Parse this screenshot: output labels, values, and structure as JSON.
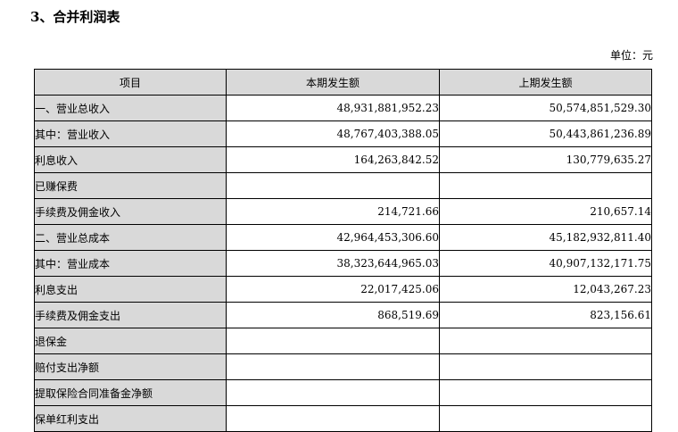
{
  "section_title": "3、合并利润表",
  "unit_label": "单位：元",
  "headers": {
    "item": "项目",
    "current": "本期发生额",
    "previous": "上期发生额"
  },
  "rows": [
    {
      "label": "一、营业总收入",
      "current": "48,931,881,952.23",
      "previous": "50,574,851,529.30"
    },
    {
      "label": "其中：营业收入",
      "current": "48,767,403,388.05",
      "previous": "50,443,861,236.89"
    },
    {
      "label": "利息收入",
      "current": "164,263,842.52",
      "previous": "130,779,635.27"
    },
    {
      "label": "已赚保费",
      "current": "",
      "previous": ""
    },
    {
      "label": "手续费及佣金收入",
      "current": "214,721.66",
      "previous": "210,657.14"
    },
    {
      "label": "二、营业总成本",
      "current": "42,964,453,306.60",
      "previous": "45,182,932,811.40"
    },
    {
      "label": "其中：营业成本",
      "current": "38,323,644,965.03",
      "previous": "40,907,132,171.75"
    },
    {
      "label": "利息支出",
      "current": "22,017,425.06",
      "previous": "12,043,267.23"
    },
    {
      "label": "手续费及佣金支出",
      "current": "868,519.69",
      "previous": "823,156.61"
    },
    {
      "label": "退保金",
      "current": "",
      "previous": ""
    },
    {
      "label": "赔付支出净额",
      "current": "",
      "previous": ""
    },
    {
      "label": "提取保险合同准备金净额",
      "current": "",
      "previous": ""
    },
    {
      "label": "保单红利支出",
      "current": "",
      "previous": ""
    }
  ]
}
